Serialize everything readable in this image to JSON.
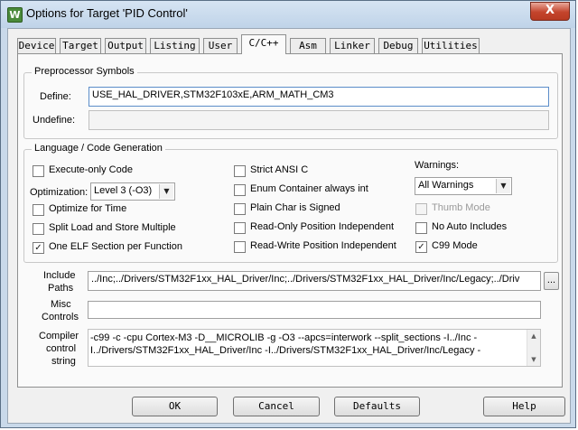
{
  "window": {
    "title": "Options for Target 'PID Control'",
    "app_icon_glyph": "W",
    "close_glyph": "X"
  },
  "tabs": [
    {
      "label": "Device"
    },
    {
      "label": "Target"
    },
    {
      "label": "Output"
    },
    {
      "label": "Listing"
    },
    {
      "label": "User"
    },
    {
      "label": "C/C++",
      "active": true
    },
    {
      "label": "Asm"
    },
    {
      "label": "Linker"
    },
    {
      "label": "Debug"
    },
    {
      "label": "Utilities"
    }
  ],
  "preprocessor": {
    "legend": "Preprocessor Symbols",
    "define_label": "Define:",
    "define_value": "USE_HAL_DRIVER,STM32F103xE,ARM_MATH_CM3",
    "undefine_label": "Undefine:",
    "undefine_value": ""
  },
  "language": {
    "legend": "Language / Code Generation",
    "execute_only": {
      "label": "Execute-only Code",
      "checked": false
    },
    "optimization_label": "Optimization:",
    "optimization_value": "Level 3 (-O3)",
    "optimize_time": {
      "label": "Optimize for Time",
      "checked": false
    },
    "split_load": {
      "label": "Split Load and Store Multiple",
      "checked": false
    },
    "one_elf": {
      "label": "One ELF Section per Function",
      "checked": true
    },
    "strict_ansi": {
      "label": "Strict ANSI C",
      "checked": false
    },
    "enum_container": {
      "label": "Enum Container always int",
      "checked": false
    },
    "plain_char": {
      "label": "Plain Char is Signed",
      "checked": false
    },
    "ro_pos": {
      "label": "Read-Only Position Independent",
      "checked": false
    },
    "rw_pos": {
      "label": "Read-Write Position Independent",
      "checked": false
    },
    "warnings_label": "Warnings:",
    "warnings_value": "All Warnings",
    "thumb_mode": {
      "label": "Thumb Mode",
      "checked": false,
      "disabled": true
    },
    "no_auto_includes": {
      "label": "No Auto Includes",
      "checked": false
    },
    "c99_mode": {
      "label": "C99 Mode",
      "checked": true
    }
  },
  "paths": {
    "include_label_1": "Include",
    "include_label_2": "Paths",
    "include_value": "../Inc;../Drivers/STM32F1xx_HAL_Driver/Inc;../Drivers/STM32F1xx_HAL_Driver/Inc/Legacy;../Driv",
    "browse_label": "...",
    "misc_label_1": "Misc",
    "misc_label_2": "Controls",
    "misc_value": "",
    "compiler_label_1": "Compiler",
    "compiler_label_2": "control",
    "compiler_label_3": "string",
    "compiler_line_1": "-c99 -c -cpu Cortex-M3 -D__MICROLIB -g -O3 --apcs=interwork --split_sections -I../Inc -",
    "compiler_line_2": "I../Drivers/STM32F1xx_HAL_Driver/Inc -I../Drivers/STM32F1xx_HAL_Driver/Inc/Legacy -"
  },
  "buttons": {
    "ok": "OK",
    "cancel": "Cancel",
    "defaults": "Defaults",
    "help": "Help"
  },
  "icons": {
    "check": "✓",
    "dropdown": "▼",
    "scroll_up": "▲",
    "scroll_down": "▼"
  },
  "colors": {
    "title_gradient_top": "#d6e4f3",
    "close_button": "#c4442c",
    "dialog_bg": "#f0f0f0"
  }
}
